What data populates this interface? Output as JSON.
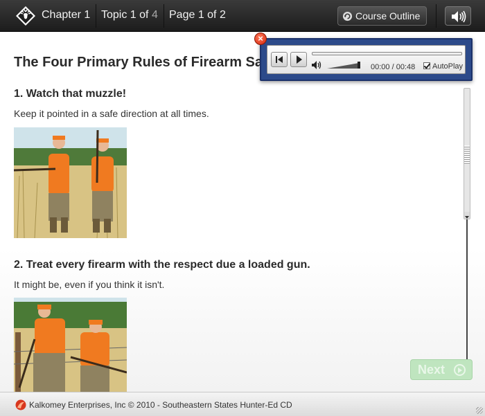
{
  "header": {
    "chapter": "Chapter 1",
    "topic_prefix": "Topic 1 of",
    "topic_total": "4",
    "page": "Page 1 of 2",
    "outline_label": "Course Outline"
  },
  "content": {
    "title": "The Four Primary Rules of Firearm Sa",
    "rules": [
      {
        "heading": "1. Watch that muzzle!",
        "text": "Keep it pointed in a safe direction at all times."
      },
      {
        "heading": "2. Treat every firearm with the respect due a loaded gun.",
        "text": "It might be, even if you think it isn't."
      }
    ]
  },
  "navigation": {
    "next_label": "Next"
  },
  "footer": {
    "text": "Kalkomey Enterprises, Inc © 2010 - Southeastern States Hunter-Ed CD"
  },
  "audio_player": {
    "time": "00:00 / 00:48",
    "autoplay_label": "AutoPlay",
    "autoplay_checked": true,
    "close_label": "×"
  },
  "colors": {
    "header_bg": "#262626",
    "audio_panel": "#2c4a8a",
    "next_button": "#bfe5bf",
    "hunter_vest": "#f07a20"
  }
}
